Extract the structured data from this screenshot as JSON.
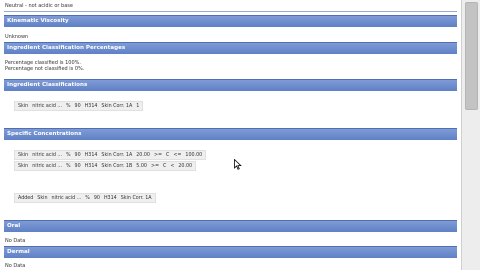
{
  "top_note": "Neutral - not acidic or base",
  "sections": {
    "kinematic": {
      "title": "Kinematic Viscosity",
      "value": "Unknown"
    },
    "ingredient_pct": {
      "title": "Ingredient Classification Percentages",
      "line1": "Percentage classified is 100%.",
      "line2": "Percentage not classified is 0%."
    },
    "ingredient_class": {
      "title": "Ingredient Classifications",
      "row": [
        "Skin",
        "nitric acid ...",
        "%",
        "90",
        "H314",
        "Skin Corr. 1A",
        "1"
      ]
    },
    "specific_conc": {
      "title": "Specific Concentrations",
      "row1": [
        "Skin",
        "nitric acid ...",
        "%",
        "90",
        "H314",
        "Skin Corr. 1A",
        "20.00",
        ">=",
        "C",
        "<=",
        "100.00"
      ],
      "row2": [
        "Skin",
        "nitric acid ...",
        "%",
        "90",
        "H314",
        "Skin Corr. 1B",
        "5.00",
        ">=",
        "C",
        "<",
        "20.00"
      ],
      "added_row": [
        "Added",
        "Skin",
        "nitric acid ...",
        "%",
        "90",
        "H314",
        "Skin Corr. 1A"
      ]
    },
    "oral": {
      "title": "Oral",
      "value": "No Data"
    },
    "dermal": {
      "title": "Dermal",
      "value": "No Data"
    }
  },
  "colors": {
    "section_bar": "#6a88cb",
    "bar_text": "#ffffff"
  }
}
